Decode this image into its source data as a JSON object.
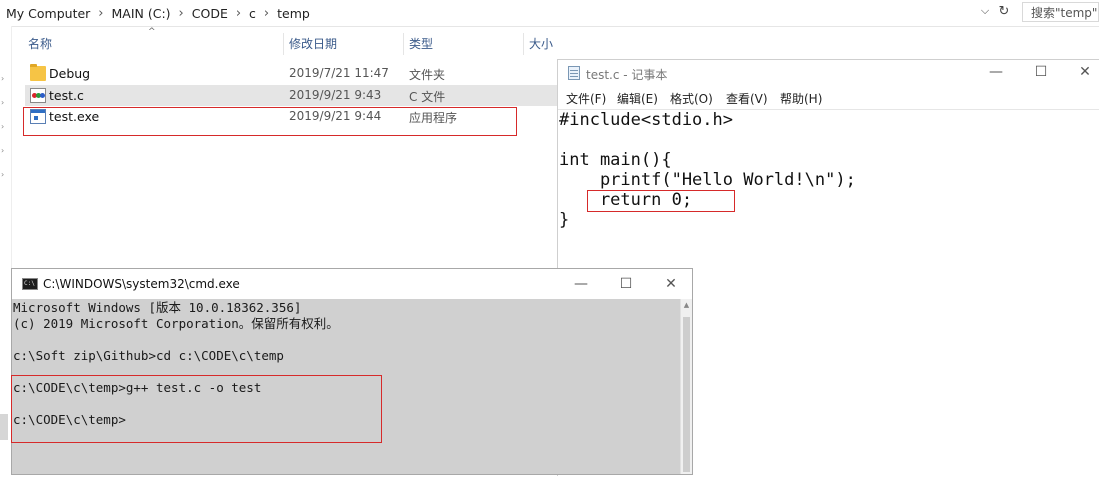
{
  "explorer": {
    "breadcrumb": [
      "My Computer",
      "MAIN (C:)",
      "CODE",
      "c",
      "temp"
    ],
    "search_placeholder": "搜索\"temp\"",
    "columns": {
      "name": "名称",
      "modified": "修改日期",
      "type": "类型",
      "size": "大小"
    },
    "files": [
      {
        "name": "Debug",
        "modified": "2019/7/21 11:47",
        "type": "文件夹",
        "icon": "folder-icon"
      },
      {
        "name": "test.c",
        "modified": "2019/9/21 9:43",
        "type": "C 文件",
        "icon": "c-source-file-icon"
      },
      {
        "name": "test.exe",
        "modified": "2019/9/21 9:44",
        "type": "应用程序",
        "icon": "executable-file-icon"
      }
    ]
  },
  "notepad": {
    "title": "test.c - 记事本",
    "menu": [
      "文件(F)",
      "编辑(E)",
      "格式(O)",
      "查看(V)",
      "帮助(H)"
    ],
    "lines": [
      "#include<stdio.h>",
      "",
      "int main(){",
      "    printf(\"Hello World!\\n\");",
      "    return 0;",
      "}"
    ]
  },
  "cmd": {
    "title": "C:\\WINDOWS\\system32\\cmd.exe",
    "lines": [
      "Microsoft Windows [版本 10.0.18362.356]",
      "(c) 2019 Microsoft Corporation。保留所有权利。",
      "",
      "c:\\Soft zip\\Github>cd c:\\CODE\\c\\temp",
      "",
      "c:\\CODE\\c\\temp>g++ test.c -o test",
      "",
      "c:\\CODE\\c\\temp>"
    ]
  },
  "window_controls": {
    "minimize": "—",
    "maximize": "☐",
    "close": "✕"
  },
  "icons": {
    "dropdown": "⌵",
    "refresh": "↻",
    "sort": "^",
    "expand": "›",
    "scroll_up": "▲"
  },
  "colors": {
    "highlight_box": "#d62a2a",
    "selected_row": "#e5e5e5",
    "console_bg": "#d0d0d0"
  }
}
